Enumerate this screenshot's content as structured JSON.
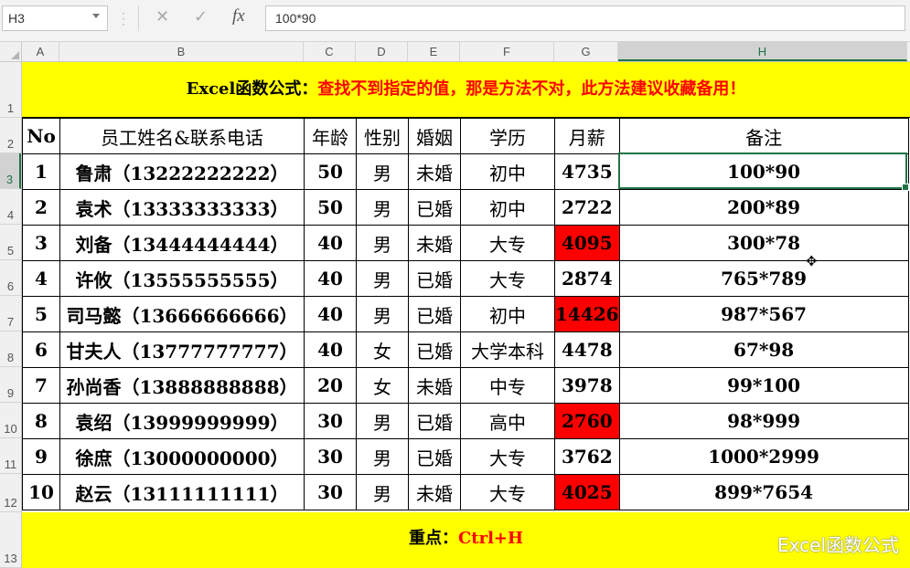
{
  "formula_bar": {
    "name_box": "H3",
    "cancel_icon": "close-icon",
    "enter_icon": "check-icon",
    "fx_label": "fx",
    "formula": "100*90"
  },
  "columns": [
    "A",
    "B",
    "C",
    "D",
    "E",
    "F",
    "G",
    "H"
  ],
  "rows": [
    "1",
    "2",
    "3",
    "4",
    "5",
    "6",
    "7",
    "8",
    "9",
    "10",
    "11",
    "12",
    "13"
  ],
  "selected_cell": "H3",
  "title": {
    "prefix": "Excel函数公式：",
    "text": "查找不到指定的值，那是方法不对，此方法建议收藏备用！"
  },
  "table": {
    "headers": [
      "No",
      "员工姓名&联系电话",
      "年龄",
      "性别",
      "婚姻",
      "学历",
      "月薪",
      "备注"
    ],
    "rows": [
      {
        "no": "1",
        "name": "鲁肃（13222222222）",
        "age": "50",
        "gender": "男",
        "marital": "未婚",
        "edu": "初中",
        "salary": "4735",
        "salary_highlight": false,
        "note": "100*90"
      },
      {
        "no": "2",
        "name": "袁术（13333333333）",
        "age": "50",
        "gender": "男",
        "marital": "已婚",
        "edu": "初中",
        "salary": "2722",
        "salary_highlight": false,
        "note": "200*89"
      },
      {
        "no": "3",
        "name": "刘备（13444444444）",
        "age": "40",
        "gender": "男",
        "marital": "未婚",
        "edu": "大专",
        "salary": "4095",
        "salary_highlight": true,
        "note": "300*78"
      },
      {
        "no": "4",
        "name": "许攸（13555555555）",
        "age": "40",
        "gender": "男",
        "marital": "已婚",
        "edu": "大专",
        "salary": "2874",
        "salary_highlight": false,
        "note": "765*789"
      },
      {
        "no": "5",
        "name": "司马懿（13666666666）",
        "age": "40",
        "gender": "男",
        "marital": "已婚",
        "edu": "初中",
        "salary": "14426",
        "salary_highlight": true,
        "note": "987*567"
      },
      {
        "no": "6",
        "name": "甘夫人（13777777777）",
        "age": "40",
        "gender": "女",
        "marital": "已婚",
        "edu": "大学本科",
        "salary": "4478",
        "salary_highlight": false,
        "note": "67*98"
      },
      {
        "no": "7",
        "name": "孙尚香（13888888888）",
        "age": "20",
        "gender": "女",
        "marital": "未婚",
        "edu": "中专",
        "salary": "3978",
        "salary_highlight": false,
        "note": "99*100"
      },
      {
        "no": "8",
        "name": "袁绍（13999999999）",
        "age": "30",
        "gender": "男",
        "marital": "已婚",
        "edu": "高中",
        "salary": "2760",
        "salary_highlight": true,
        "note": "98*999"
      },
      {
        "no": "9",
        "name": "徐庶（13000000000）",
        "age": "30",
        "gender": "男",
        "marital": "已婚",
        "edu": "大专",
        "salary": "3762",
        "salary_highlight": false,
        "note": "1000*2999"
      },
      {
        "no": "10",
        "name": "赵云（13111111111）",
        "age": "30",
        "gender": "男",
        "marital": "未婚",
        "edu": "大专",
        "salary": "4025",
        "salary_highlight": true,
        "note": "899*7654"
      }
    ]
  },
  "footer": {
    "prefix": "重点：",
    "shortcut": "Ctrl+H"
  },
  "watermark": "Excel函数公式",
  "colors": {
    "band_yellow": "#ffff00",
    "highlight_red": "#ff0000",
    "selection_green": "#217346"
  }
}
